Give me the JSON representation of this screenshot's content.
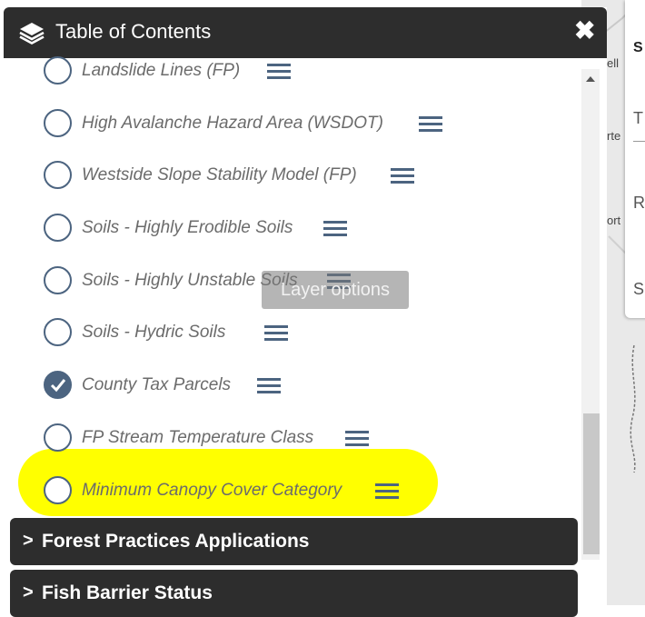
{
  "panel": {
    "title": "Table of Contents",
    "close_symbol": "✖"
  },
  "layers": [
    {
      "label": "Landslide Lines (FP)",
      "checked": false
    },
    {
      "label": "High Avalanche Hazard Area (WSDOT)",
      "checked": false
    },
    {
      "label": "Westside Slope Stability Model (FP)",
      "checked": false
    },
    {
      "label": "Soils - Highly Erodible Soils",
      "checked": false
    },
    {
      "label": "Soils - Highly Unstable Soils",
      "checked": false
    },
    {
      "label": "Soils - Hydric Soils",
      "checked": false
    },
    {
      "label": "County Tax Parcels",
      "checked": true
    },
    {
      "label": "FP Stream Temperature Class",
      "checked": false
    },
    {
      "label": "Minimum Canopy Cover Category",
      "checked": false
    }
  ],
  "tooltip": "Layer options",
  "sections": [
    {
      "chevron": ">",
      "label": "Forest Practices Applications"
    },
    {
      "chevron": ">",
      "label": "Fish Barrier Status"
    }
  ],
  "map_fragments": {
    "texts": [
      "ell",
      "rte",
      "ort"
    ],
    "side_letters": [
      "S",
      "T",
      "R",
      "S"
    ]
  },
  "colors": {
    "header_bg": "#2d2d2d",
    "accent": "#4c6480",
    "highlight": "#ffff00"
  }
}
